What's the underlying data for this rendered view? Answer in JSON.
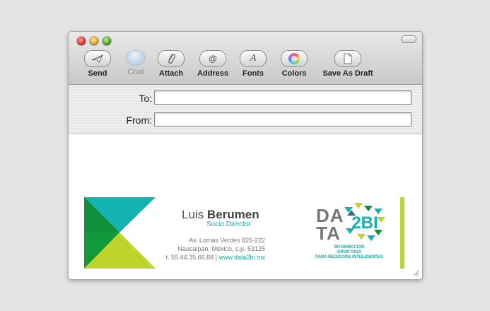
{
  "toolbar": {
    "items": [
      {
        "label": "Send",
        "icon": "send-icon"
      },
      {
        "label": "Chat",
        "icon": "chat-icon",
        "disabled": true
      },
      {
        "label": "Attach",
        "icon": "paperclip-icon"
      },
      {
        "label": "Address",
        "icon": "at-icon"
      },
      {
        "label": "Fonts",
        "icon": "font-icon"
      },
      {
        "label": "Colors",
        "icon": "color-wheel-icon"
      },
      {
        "label": "Save As Draft",
        "icon": "draft-document-icon"
      }
    ]
  },
  "headers": {
    "to_label": "To:",
    "to_value": "",
    "from_label": "From:",
    "from_value": ""
  },
  "signature": {
    "first_name": "Luis",
    "last_name": "Berumen",
    "title": "Socio Director",
    "address_line1": "Av. Lomas Verdes 825-222",
    "address_line2": "Naucalpan, México, c.p. 53125",
    "phone": "t. 55.44.35.66.88 |",
    "website": "www.data2bi.mx",
    "logo_text_line1": "DA",
    "logo_text_line2": "TA",
    "logo_2bi": "2BI",
    "tagline_line1": "INFORMACIÓN",
    "tagline_line2": "OPORTUNA",
    "tagline_line3": "PARA NEGOCIOS INTELIGENTES"
  },
  "colors": {
    "brand_teal": "#12b3b0",
    "brand_lime": "#bfd42a",
    "brand_green": "#159b3a"
  }
}
